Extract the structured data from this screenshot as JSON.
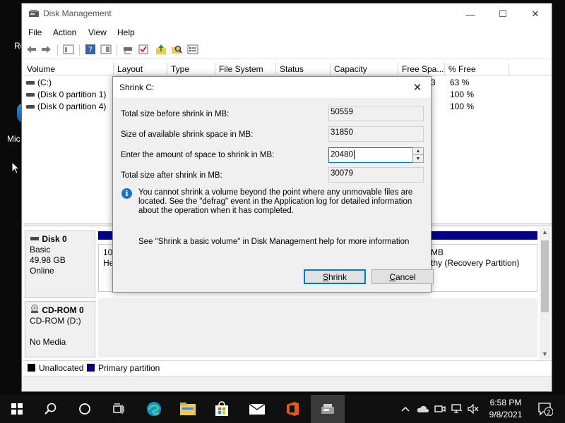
{
  "window": {
    "title": "Disk Management",
    "minimize": "—",
    "maximize": "☐",
    "close": "✕"
  },
  "menu": [
    "File",
    "Action",
    "View",
    "Help"
  ],
  "desktop": {
    "frag_top": "Re",
    "frag_mid": "Mic"
  },
  "volume_table": {
    "headers": [
      "Volume",
      "Layout",
      "Type",
      "File System",
      "Status",
      "Capacity",
      "Free Spa...",
      "% Free"
    ],
    "rows": [
      {
        "name": "(C:)",
        "free_frag": "3",
        "pct": "63 %"
      },
      {
        "name": "(Disk 0 partition 1)",
        "free_frag": "",
        "pct": "100 %"
      },
      {
        "name": "(Disk 0 partition 4)",
        "free_frag": "",
        "pct": "100 %"
      }
    ]
  },
  "disk0": {
    "name": "Disk 0",
    "type": "Basic",
    "size": "49.98 GB",
    "status": "Online",
    "part1_line1": "100",
    "part1_line2": "He",
    "part4_line1": "MB",
    "part4_line2": "thy (Recovery Partition)"
  },
  "cdrom": {
    "name": "CD-ROM 0",
    "drive": "CD-ROM (D:)",
    "media": "No Media"
  },
  "legend": {
    "unallocated": "Unallocated",
    "primary": "Primary partition",
    "unallocated_color": "#000000",
    "primary_color": "#00008b"
  },
  "dialog": {
    "title": "Shrink C:",
    "close": "✕",
    "label_before": "Total size before shrink in MB:",
    "value_before": "50559",
    "label_available": "Size of available shrink space in MB:",
    "value_available": "31850",
    "label_amount": "Enter the amount of space to shrink in MB:",
    "value_amount": "20480",
    "label_after": "Total size after shrink in MB:",
    "value_after": "30079",
    "info_icon": "i",
    "info_text": "You cannot shrink a volume beyond the point where any unmovable files are located. See the \"defrag\" event in the Application log for detailed information about the operation when it has completed.",
    "help_text": "See \"Shrink a basic volume\" in Disk Management help for more information",
    "shrink_label_pre": "",
    "shrink_label_u": "S",
    "shrink_label_post": "hrink",
    "cancel_label_pre": "",
    "cancel_label_u": "C",
    "cancel_label_post": "ancel"
  },
  "taskbar": {
    "time": "6:58 PM",
    "date": "9/8/2021",
    "notification_count": "2",
    "accent": "#0078d7"
  }
}
